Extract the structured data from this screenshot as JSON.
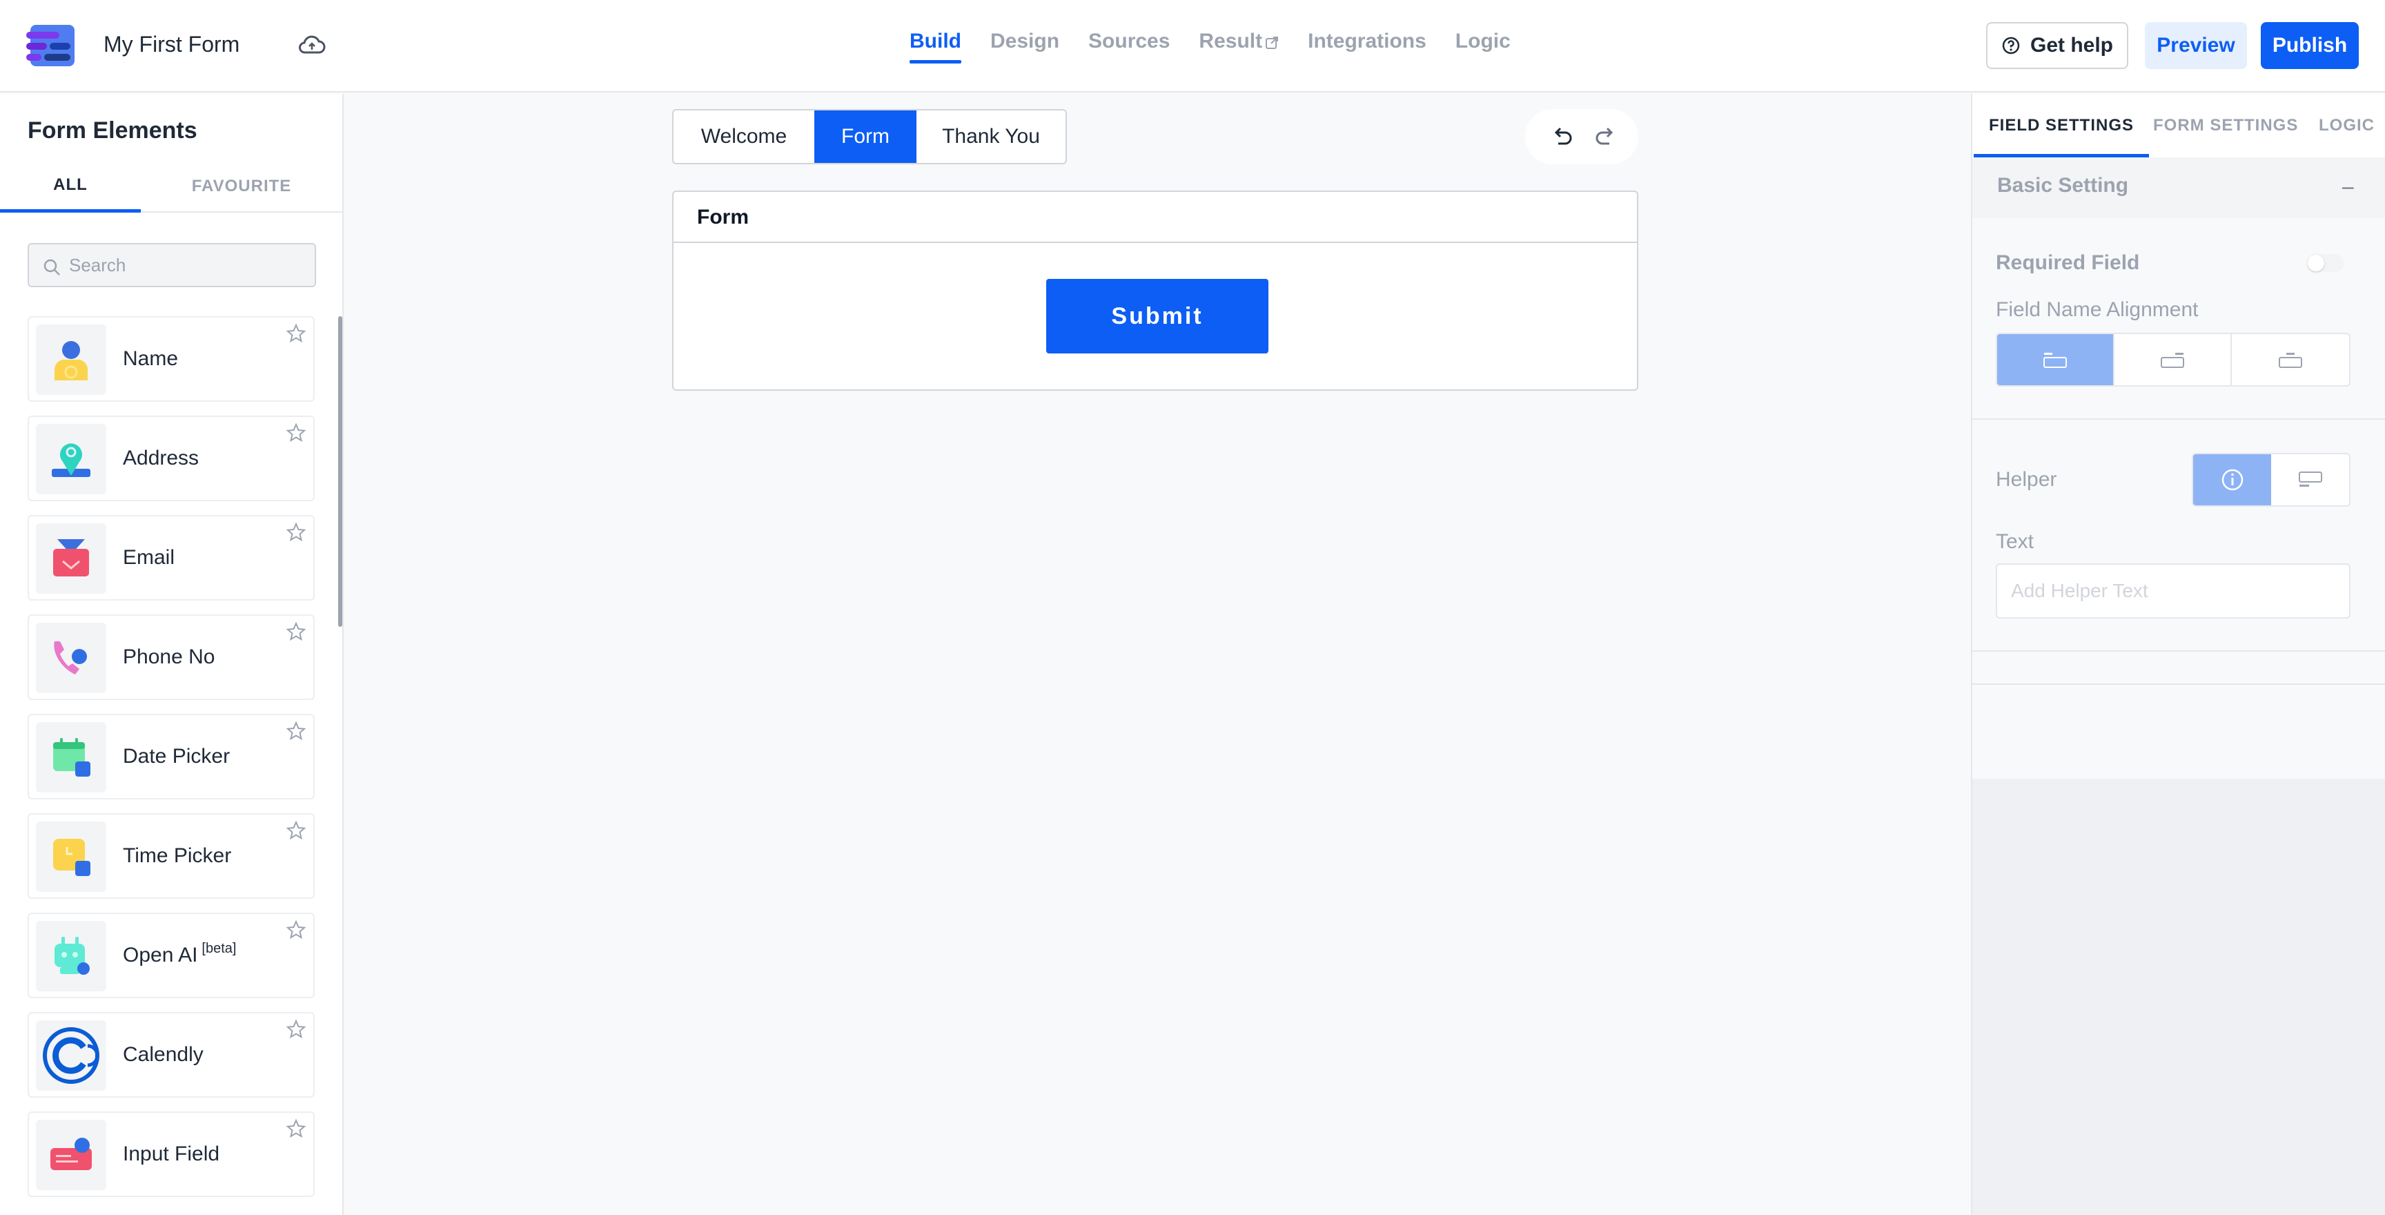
{
  "header": {
    "form_title": "My First Form",
    "nav": [
      {
        "label": "Build",
        "active": true
      },
      {
        "label": "Design",
        "active": false
      },
      {
        "label": "Sources",
        "active": false
      },
      {
        "label": "Result",
        "active": false
      },
      {
        "label": "Integrations",
        "active": false
      },
      {
        "label": "Logic",
        "active": false
      }
    ],
    "get_help_label": "Get help",
    "preview_label": "Preview",
    "publish_label": "Publish"
  },
  "sidebar": {
    "title": "Form Elements",
    "tabs": [
      {
        "label": "ALL",
        "active": true
      },
      {
        "label": "FAVOURITE",
        "active": false
      }
    ],
    "search_placeholder": "Search",
    "elements": [
      {
        "label": "Name",
        "icon": "person-icon"
      },
      {
        "label": "Address",
        "icon": "location-icon"
      },
      {
        "label": "Email",
        "icon": "envelope-icon"
      },
      {
        "label": "Phone No",
        "icon": "phone-icon"
      },
      {
        "label": "Date Picker",
        "icon": "calendar-icon"
      },
      {
        "label": "Time Picker",
        "icon": "clock-icon"
      },
      {
        "label": "Open AI",
        "badge": "[beta]",
        "icon": "robot-icon"
      },
      {
        "label": "Calendly",
        "icon": "calendly-logo-icon"
      },
      {
        "label": "Input Field",
        "icon": "input-field-icon"
      }
    ]
  },
  "canvas": {
    "page_tabs": [
      {
        "label": "Welcome",
        "active": false
      },
      {
        "label": "Form",
        "active": true
      },
      {
        "label": "Thank You",
        "active": false
      }
    ],
    "form_card_title": "Form",
    "submit_label": "Submit"
  },
  "right_panel": {
    "tabs": [
      {
        "label": "FIELD SETTINGS",
        "active": true
      },
      {
        "label": "FORM SETTINGS",
        "active": false
      },
      {
        "label": "LOGIC",
        "active": false
      }
    ],
    "basic_setting_title": "Basic Setting",
    "collapse_symbol": "–",
    "required_field_label": "Required Field",
    "field_name_alignment_label": "Field Name Alignment",
    "helper_label": "Helper",
    "text_label": "Text",
    "helper_text_placeholder": "Add Helper Text"
  },
  "colors": {
    "accent": "#0d5ef4",
    "accent_light": "#e6effd",
    "selected_option": "#8db3f5"
  }
}
